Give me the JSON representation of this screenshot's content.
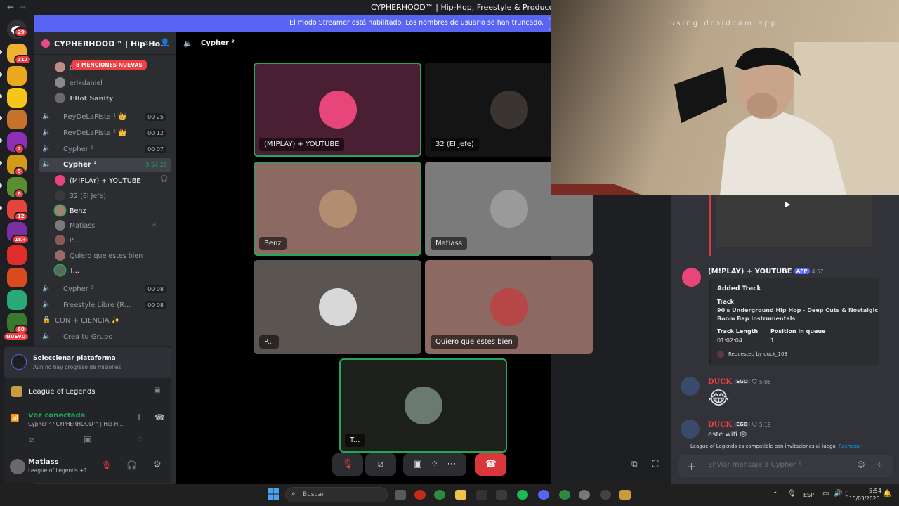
{
  "window": {
    "title": "CYPHERHOOD™ | Hip-Hop, Freestyle & Producción Musical",
    "streamer_banner": "El modo Streamer está habilitado. Los nombres de usuario se han truncado."
  },
  "servers": {
    "home_badge": "29",
    "badges": [
      "317",
      "2",
      "5",
      "8",
      "12",
      "1K+",
      "60"
    ],
    "new_label": "NUEVO"
  },
  "guild": {
    "name": "CYPHERHOOD™ | Hip-Ho...",
    "mentions_pill": "8 MENCIONES NUEVAS"
  },
  "channels": {
    "top_users": [
      "B...",
      "erikdaniel",
      "Eliot Sanity"
    ],
    "list": [
      {
        "name": "ReyDeLaPista ¹ 👑",
        "count": "00 25"
      },
      {
        "name": "ReyDeLaPista ² 👑",
        "count": "00 12"
      },
      {
        "name": "Cypher ¹",
        "count": "00 07"
      },
      {
        "name": "Cypher ²",
        "count": "3:54:20"
      },
      {
        "name": "Cypher ³",
        "count": "00 08"
      },
      {
        "name": "Freestyle Libre (R...",
        "count": "00 08"
      },
      {
        "name": "CON + CIENCIA ✨",
        "count": ""
      },
      {
        "name": "Crea tu Grupo",
        "count": ""
      }
    ],
    "voice_users": [
      "(M!PLAY) + YOUTUBE",
      "32 (El Jefe)",
      "Benz",
      "Matiass",
      "P...",
      "Quiero que estes bien",
      "T..."
    ]
  },
  "panel": {
    "platform_title": "Seleccionar plataforma",
    "platform_sub": "Aún no hay progreso de misiones",
    "game": "League of Legends",
    "voice_status": "Voz conectada",
    "voice_channel": "Cypher ² / CYPHERHOOD™ | Hip-H...",
    "username": "Matiass",
    "activity": "League of Legends +1"
  },
  "stage": {
    "channel": "Cypher ²",
    "tiles": [
      {
        "name": "(M!PLAY) + YOUTUBE"
      },
      {
        "name": "32 (El Jefe)"
      },
      {
        "name": "Benz"
      },
      {
        "name": "Matiass"
      },
      {
        "name": "P..."
      },
      {
        "name": "Quiero que estes bien"
      },
      {
        "name": "T..."
      }
    ]
  },
  "cam": {
    "overlay": "using droidcam.app"
  },
  "chat": {
    "bot_name": "(M!PLAY) + YOUTUBE",
    "bot_tag": "APP",
    "bot_time": "4:57",
    "embed": {
      "title": "Added Track",
      "track_label": "Track",
      "track_line1": "90's Underground Hip Hop - Deep Cuts & Nostalgic",
      "track_line2": "Boom Bap Instrumentals",
      "length_label": "Track Length",
      "length_value": "01:02:04",
      "position_label": "Position in queue",
      "position_value": "1",
      "requested": "Requested by duck_103"
    },
    "duck_name": "DUCK",
    "duck_tag": "EGO",
    "duck_time1": "5:06",
    "duck_emoji": "😂",
    "duck_time2": "5:19",
    "duck_text": "este wifi 😢",
    "lol_notice": "League of Legends es compatible con invitaciones al juego.",
    "lol_reject": "Rechazar",
    "input_placeholder": "Enviar mensaje a  Cypher ²"
  },
  "taskbar": {
    "search_placeholder": "Buscar",
    "lang": "ESP",
    "time": "5:54",
    "date": "15/03/2026"
  }
}
